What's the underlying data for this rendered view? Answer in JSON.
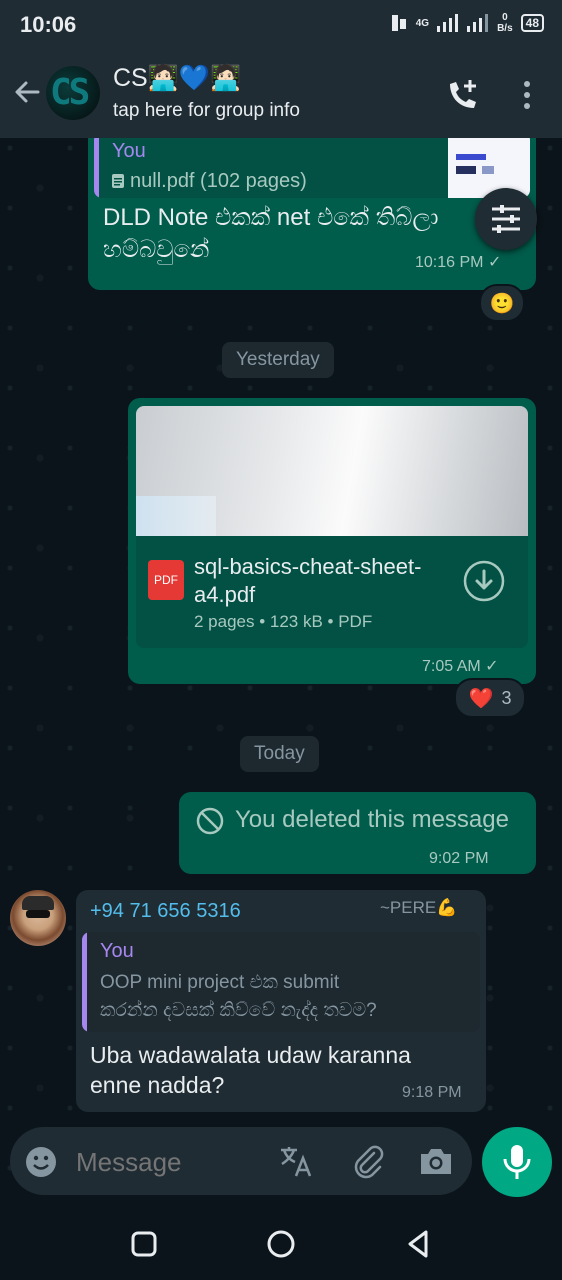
{
  "status": {
    "time": "10:06",
    "network_label": "4G",
    "speed_value": "0",
    "speed_unit": "B/s",
    "battery": "48"
  },
  "header": {
    "group_name": "CS🧑🏻‍💻💙🧑🏻‍💻",
    "subtitle": "tap here for group info",
    "avatar_text": "CS"
  },
  "messages": {
    "msg1": {
      "quote_author": "You",
      "quote_file": "null.pdf (102 pages)",
      "text_line1": "DLD Note එකක් net එකේ තිබ්ලා",
      "text_line2": "හම්බවුනේ",
      "time": "10:16 PM",
      "reaction": "🙂"
    },
    "day_yesterday": "Yesterday",
    "msg2": {
      "file_name_line1": "sql-basics-cheat-sheet-",
      "file_name_line2": "a4.pdf",
      "file_icon_label": "PDF",
      "file_meta": "2 pages • 123 kB • PDF",
      "time": "7:05 AM",
      "reaction_emoji": "❤️",
      "reaction_count": "3"
    },
    "day_today": "Today",
    "msg3": {
      "text": "You deleted this message",
      "time": "9:02 PM"
    },
    "msg4": {
      "sender_number": "+94 71 656 5316",
      "sender_name": "~PERE💪",
      "quote_author": "You",
      "quote_line1": "OOP mini project එක submit",
      "quote_line2": "කරන්න දවසක් කිව්වේ නැද්ද තවම?",
      "text_line1": "Uba wadawalata udaw karanna",
      "text_line2": "enne nadda?",
      "time": "9:18 PM"
    }
  },
  "composer": {
    "placeholder": "Message"
  },
  "colors": {
    "outgoing_bubble": "#005c4b",
    "incoming_bubble": "#1f2c34",
    "accent": "#00a884",
    "quote_bar": "#a687f0",
    "sender_color": "#53bdeb"
  }
}
